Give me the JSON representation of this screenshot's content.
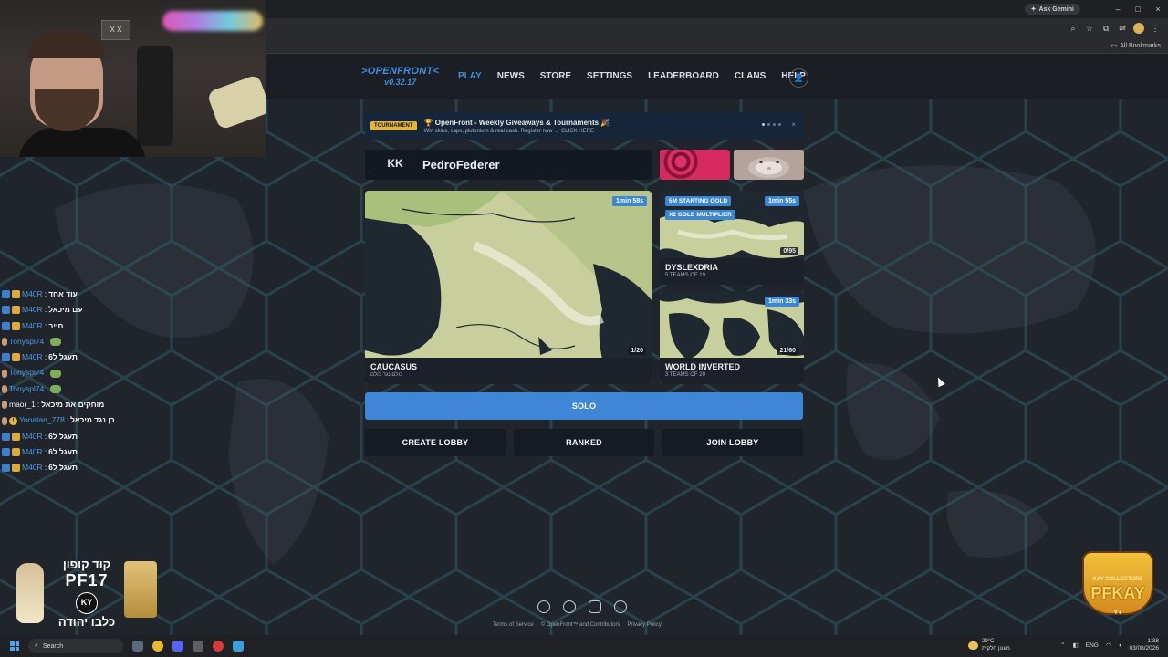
{
  "browser": {
    "ask_gemini": "Ask Gemini",
    "all_bookmarks": "All Bookmarks",
    "window_controls": [
      "–",
      "□",
      "×"
    ]
  },
  "nav": {
    "logo_name": ">OPENFRONT<",
    "version": "v0.32.17",
    "links": [
      "PLAY",
      "NEWS",
      "STORE",
      "SETTINGS",
      "LEADERBOARD",
      "CLANS",
      "HELP"
    ],
    "active": "PLAY"
  },
  "banner": {
    "badge": "TOURNAMENT",
    "title": "🏆 OpenFront - Weekly Giveaways & Tournaments 🎉",
    "subtitle": "Win skins, caps, plutonium & real cash. Register now → CLICK HERE",
    "close": "×"
  },
  "player": {
    "clan_tag": "KK",
    "username": "PedroFederer"
  },
  "lobbies": [
    {
      "name": "CAUCASUS",
      "subtitle": "כולם נגד כולם",
      "time": "1min 58s",
      "players": "1/20",
      "modifiers": []
    },
    {
      "name": "DYSLEXDRIA",
      "subtitle": "5 TEAMS OF 19",
      "time": "1min 55s",
      "players": "0/95",
      "modifiers": [
        "5M STARTING GOLD",
        "X2 GOLD MULTIPLIER"
      ]
    },
    {
      "name": "WORLD INVERTED",
      "subtitle": "3 TEAMS OF 20",
      "time": "1min 33s",
      "players": "21/60",
      "modifiers": []
    }
  ],
  "buttons": {
    "solo": "SOLO",
    "create_lobby": "CREATE LOBBY",
    "ranked": "RANKED",
    "join_lobby": "JOIN LOBBY"
  },
  "footer": {
    "terms": "Terms of Service",
    "copyright": "© OpenFront™ and Contributors",
    "privacy": "Privacy Policy",
    "icons": [
      "github-icon",
      "reddit-icon",
      "discord-icon",
      "globe-icon"
    ]
  },
  "webcam": {
    "box_text": "X X"
  },
  "chat": [
    {
      "user": "M40R",
      "msg": "עוד אחד",
      "badge": "blue-gold"
    },
    {
      "user": "M40R",
      "msg": "עם מיכאל",
      "badge": "blue-gold"
    },
    {
      "user": "M40R",
      "msg": "חייב",
      "badge": "blue-gold"
    },
    {
      "user": "Tonyspl74",
      "msg": "",
      "badge": "gray",
      "emote": true
    },
    {
      "user": "M40R",
      "msg": "תעגל ל6",
      "badge": "blue-gold"
    },
    {
      "user": "Tonyspl74",
      "msg": "",
      "badge": "gray",
      "emote": true
    },
    {
      "user": "Tonyspl74",
      "msg": "",
      "badge": "gray",
      "emote": true
    },
    {
      "user": "maor_1",
      "msg": "מוחקים את מיכאל",
      "badge": "gray"
    },
    {
      "user": "Yonatan_778",
      "msg": "כן נגד מיכאל",
      "badge": "warn"
    },
    {
      "user": "M40R",
      "msg": "תעגל ל6",
      "badge": "blue-gold"
    },
    {
      "user": "M40R",
      "msg": "תעגל ל6",
      "badge": "blue-gold"
    },
    {
      "user": "M40R",
      "msg": "תעגל ל6",
      "badge": "blue-gold"
    }
  ],
  "promo": {
    "line1": "קוד קופון",
    "code": "PF17",
    "logo": "KY",
    "line3": "כלבו יהודה"
  },
  "pfkay": {
    "top": "KAY COLLECTORS",
    "name": "PFKAY",
    "bottom": "YT"
  },
  "taskbar": {
    "search_placeholder": "Search",
    "temp": "29°C",
    "weather_desc": "מעונן חלקית",
    "lang": "ENG",
    "time": "1:38",
    "date": "03/08/2026"
  },
  "colors": {
    "accent": "#3f86d6",
    "tournament_badge": "#e4b53a",
    "page_bg": "#1e2228"
  }
}
